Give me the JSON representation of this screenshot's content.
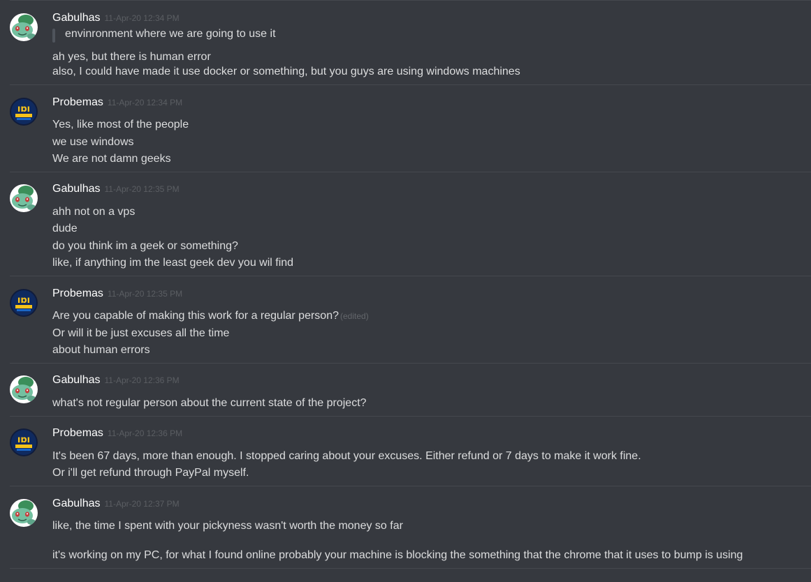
{
  "colors": {
    "background": "#36393f",
    "username": "#ffffff",
    "message_text": "#dcddde",
    "timestamp": "#5b5e63",
    "divider": "#45484e"
  },
  "messages": [
    {
      "author": "Gabulhas",
      "avatar": "bulbasaur-avatar",
      "time": "11-Apr-20 12:34 PM",
      "quote": "envinronment where we are going to use it",
      "lines": [
        "ah yes, but there is human error",
        "also, I could  have made it use docker or something, but you guys are using windows machines"
      ]
    },
    {
      "author": "Probemas",
      "avatar": "probemas-logo-avatar",
      "time": "11-Apr-20 12:34 PM",
      "lines": [
        "Yes, like most of the people",
        "we use windows",
        "We are not damn geeks"
      ]
    },
    {
      "author": "Gabulhas",
      "avatar": "bulbasaur-avatar",
      "time": "11-Apr-20 12:35 PM",
      "lines": [
        "ahh not on a vps",
        "dude",
        "do you think im a geek or something?",
        "like, if anything im the least geek dev you wil find"
      ]
    },
    {
      "author": "Probemas",
      "avatar": "probemas-logo-avatar",
      "time": "11-Apr-20 12:35 PM",
      "lines": [
        "Are you capable of making this work for a regular person?",
        "Or will it be just excuses all the time",
        "about human errors"
      ],
      "edited_label": "(edited)"
    },
    {
      "author": "Gabulhas",
      "avatar": "bulbasaur-avatar",
      "time": "11-Apr-20 12:36 PM",
      "lines": [
        "what's not regular person about the current state of the project?"
      ]
    },
    {
      "author": "Probemas",
      "avatar": "probemas-logo-avatar",
      "time": "11-Apr-20 12:36 PM",
      "lines": [
        "It's been 67 days, more than enough. I stopped caring about your excuses. Either refund or 7 days to make it work fine.",
        "Or i'll get refund through PayPal myself."
      ]
    },
    {
      "author": "Gabulhas",
      "avatar": "bulbasaur-avatar",
      "time": "11-Apr-20 12:37 PM",
      "lines": [
        "like, the time I spent with your pickyness wasn't worth the money so far",
        "it's working on my PC, for what I found online probably your machine is blocking the something that the chrome that it uses to bump is using"
      ]
    }
  ]
}
